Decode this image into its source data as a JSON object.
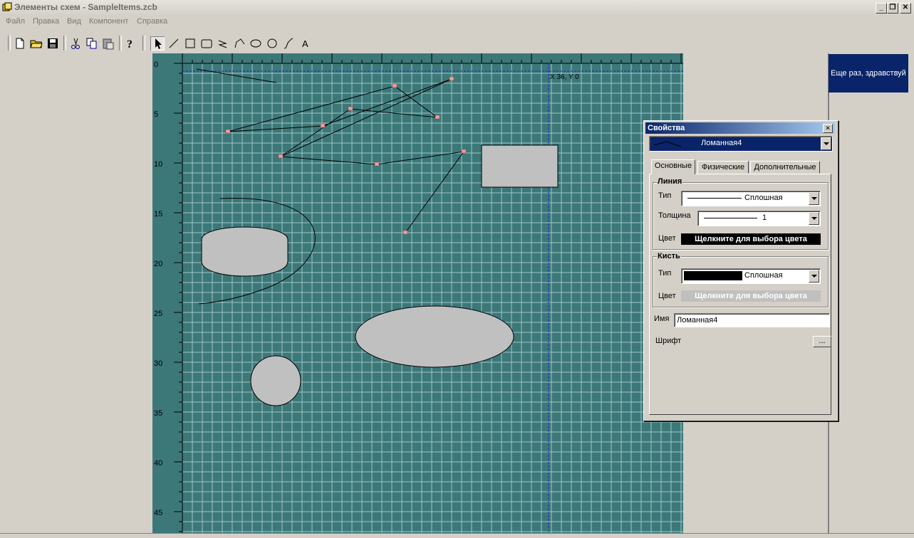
{
  "window": {
    "title": "Элементы схем - SampleItems.zcb",
    "controls": {
      "minimize": "_",
      "restore": "❐",
      "close": "✕"
    }
  },
  "menu": [
    "Файл",
    "Правка",
    "Вид",
    "Компонент",
    "Справка"
  ],
  "toolbar": {
    "buttons": [
      "new-file-icon",
      "open-folder-icon",
      "save-icon",
      "cut-icon",
      "copy-icon",
      "paste-icon",
      "help-icon",
      "pointer-tool-icon",
      "line-tool-icon",
      "rect-tool-icon",
      "round-rect-tool-icon",
      "polygon-tool-icon",
      "polyline-tool-icon",
      "ellipse-tool-icon",
      "circle-tool-icon",
      "curve-tool-icon",
      "text-tool-icon"
    ],
    "text_tool_label": "A",
    "active": "pointer-tool-icon"
  },
  "canvas": {
    "ruler_labels": [
      "0",
      "5",
      "10",
      "15",
      "20",
      "25",
      "30",
      "35",
      "40",
      "45"
    ],
    "cursor_readout": "X 36, Y 0",
    "colors": {
      "ruler": "#3d7879",
      "grid_bg": "#3d7879",
      "grid_line": "#9fc6c6",
      "shape_fill": "#c0c0c0",
      "guide": "#2020d0",
      "node": "#e8a0a0"
    }
  },
  "banner": {
    "text": "Еще раз, здравствуй"
  },
  "properties": {
    "title": "Свойства",
    "close": "✕",
    "object_selector": "Ломанная4",
    "tabs": [
      {
        "label": "Основные",
        "active": true
      },
      {
        "label": "Физические",
        "active": false
      },
      {
        "label": "Дополнительные",
        "active": false
      }
    ],
    "line_group": {
      "title": "Линия",
      "type_label": "Тип",
      "type_value": "Сплошная",
      "width_label": "Толщина",
      "width_value": "1",
      "color_label": "Цвет",
      "color_button": "Щелкните для выбора цвета"
    },
    "brush_group": {
      "title": "Кисть",
      "type_label": "Тип",
      "type_value": "Сплошная",
      "color_label": "Цвет",
      "color_button": "Щелкните для выбора цвета"
    },
    "name_label": "Имя",
    "name_value": "Ломанная4",
    "font_label": "Шрифт",
    "font_button": "..."
  }
}
